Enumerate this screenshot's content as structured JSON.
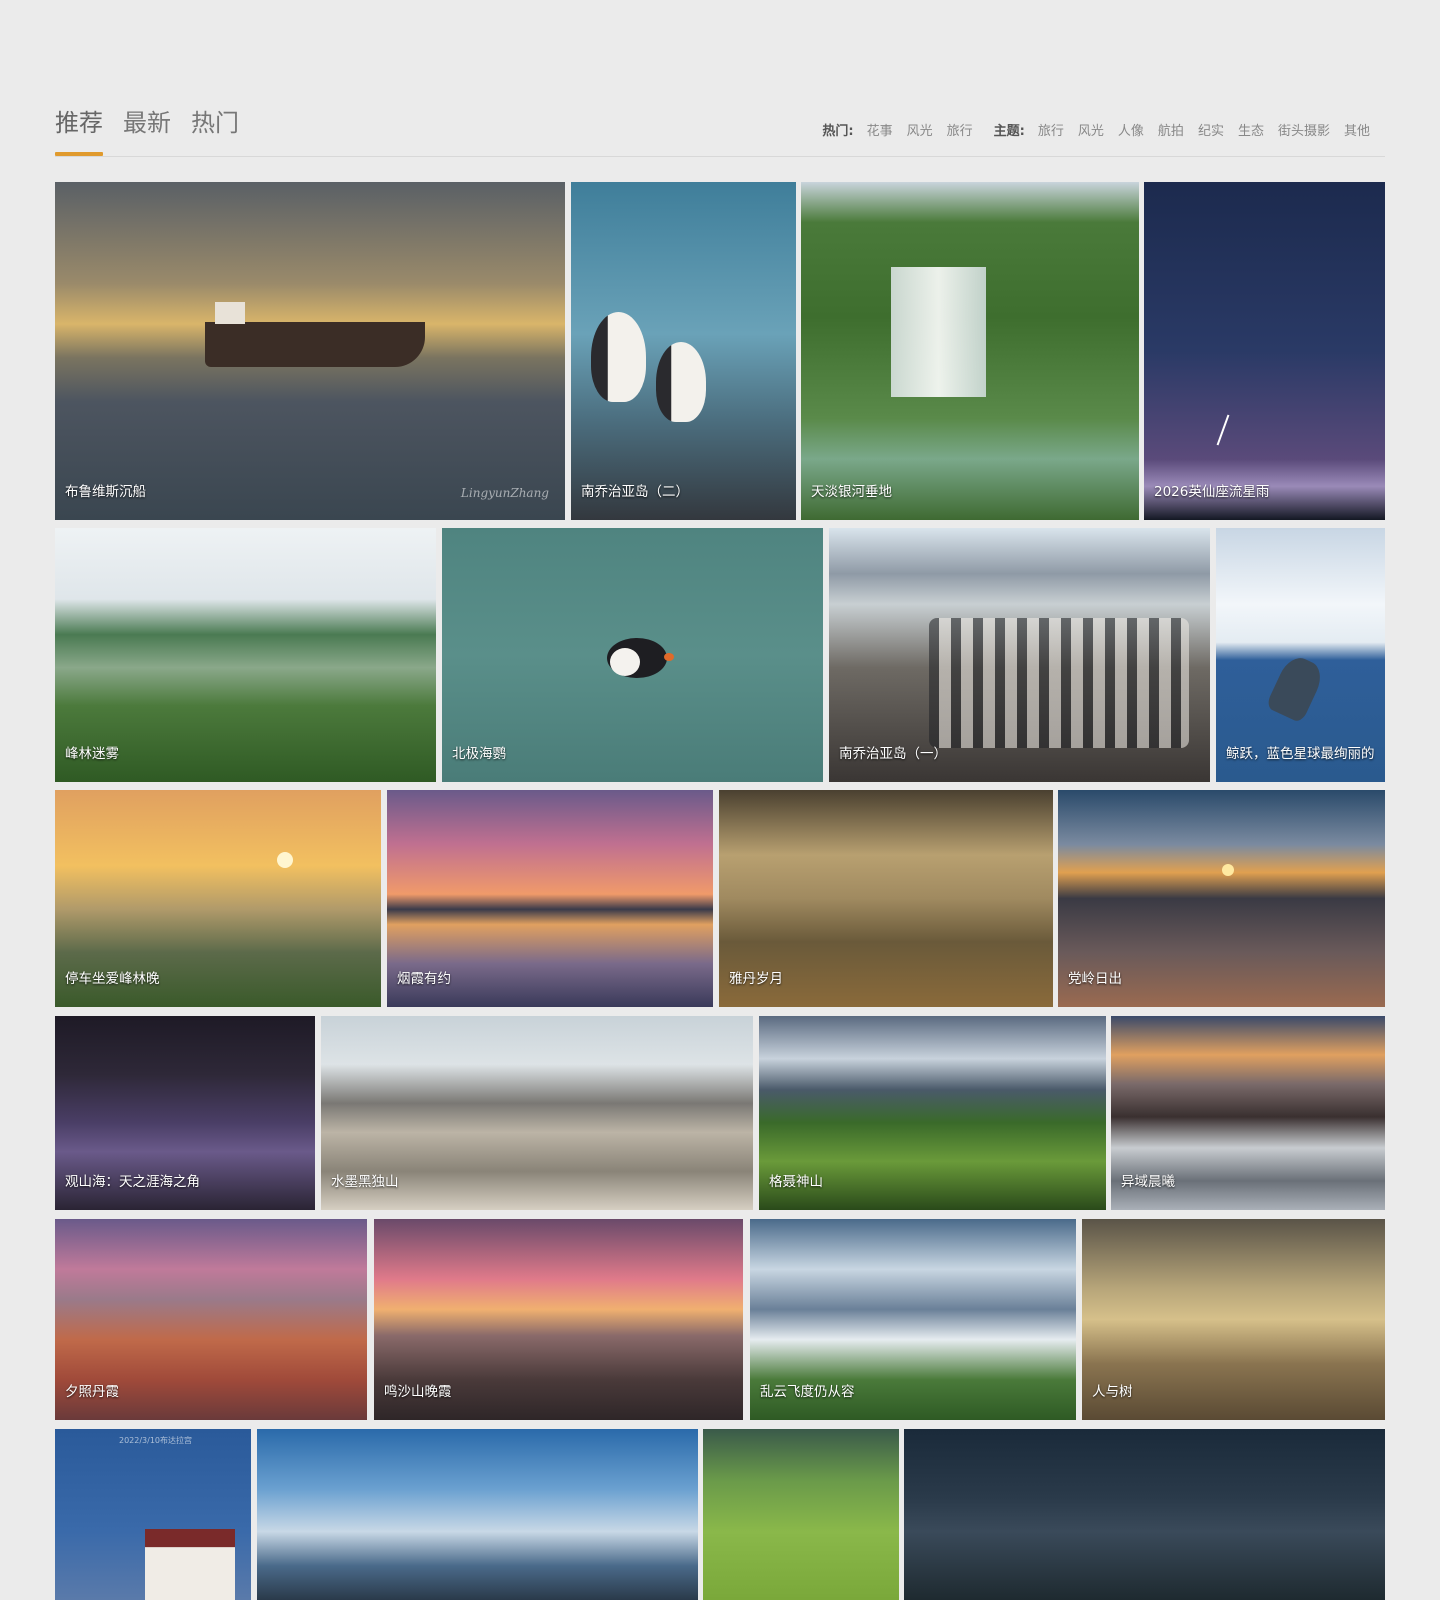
{
  "tabs": [
    "推荐",
    "最新",
    "热门"
  ],
  "hot": {
    "label": "热门:",
    "items": [
      "花事",
      "风光",
      "旅行"
    ]
  },
  "theme": {
    "label": "主题:",
    "items": [
      "旅行",
      "风光",
      "人像",
      "航拍",
      "纪实",
      "生态",
      "街头摄影",
      "其他"
    ]
  },
  "photos": [
    {
      "title": "布鲁维斯沉船",
      "signature": "LingyunZhang"
    },
    {
      "title": "南乔治亚岛（二）"
    },
    {
      "title": "天淡银河垂地"
    },
    {
      "title": "2026英仙座流星雨"
    },
    {
      "title": "峰林迷雾"
    },
    {
      "title": "北极海鹦"
    },
    {
      "title": "南乔治亚岛（一）"
    },
    {
      "title": "鲸跃，蓝色星球最绚丽的"
    },
    {
      "title": "停车坐爱峰林晚"
    },
    {
      "title": "烟霞有约"
    },
    {
      "title": "雅丹岁月"
    },
    {
      "title": "党岭日出"
    },
    {
      "title": "观山海：天之涯海之角"
    },
    {
      "title": "水墨黑独山"
    },
    {
      "title": "格聂神山"
    },
    {
      "title": "异域晨曦"
    },
    {
      "title": "夕照丹霞"
    },
    {
      "title": "鸣沙山晚霞"
    },
    {
      "title": "乱云飞度仍从容"
    },
    {
      "title": "人与树"
    },
    {
      "title": "",
      "stamp": "2022/3/10布达拉宫"
    },
    {
      "title": ""
    },
    {
      "title": ""
    },
    {
      "title": ""
    }
  ],
  "colors": {
    "background": "#ebebeb",
    "accent": "#e09a2d"
  }
}
